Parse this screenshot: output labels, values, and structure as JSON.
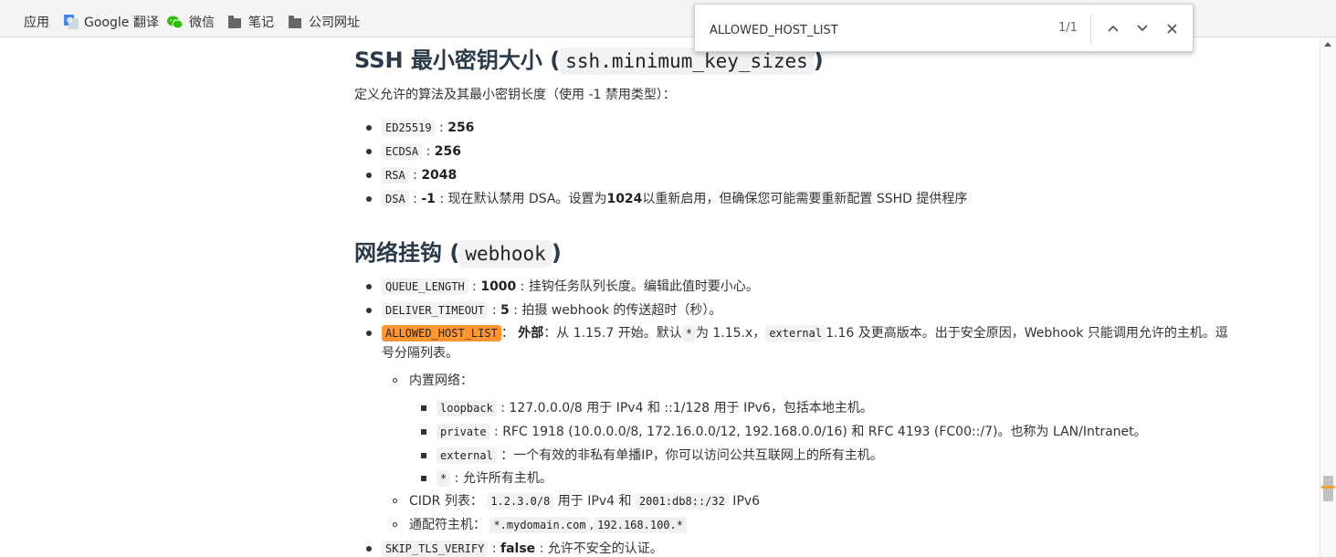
{
  "bookmarks": [
    {
      "label": "应用",
      "icon": "apps-grid-icon"
    },
    {
      "label": "Google 翻译",
      "icon": "google-translate-icon"
    },
    {
      "label": "微信",
      "icon": "wechat-icon"
    },
    {
      "label": "笔记",
      "icon": "folder-icon"
    },
    {
      "label": "公司网址",
      "icon": "folder-icon"
    }
  ],
  "find": {
    "query": "ALLOWED_HOST_LIST",
    "count": "1/1"
  },
  "ssh": {
    "heading_text": "SSH 最小密钥大小 (",
    "heading_code": "ssh.minimum_key_sizes",
    "heading_close": ")",
    "desc": "定义允许的算法及其最小密钥长度（使用 -1 禁用类型）：",
    "items": [
      {
        "code": "ED25519",
        "sep": " : ",
        "value": "256",
        "rest": ""
      },
      {
        "code": "ECDSA",
        "sep": " : ",
        "value": "256",
        "rest": ""
      },
      {
        "code": "RSA",
        "sep": " : ",
        "value": "2048",
        "rest": ""
      },
      {
        "code": "DSA",
        "sep": " : ",
        "value": "-1",
        "rest": " : 现在默认禁用 DSA。设置为",
        "bold2": "1024",
        "rest2": "以重新启用，但确保您可能需要重新配置 SSHD 提供程序"
      }
    ]
  },
  "webhook": {
    "heading_text": "网络挂钩 (",
    "heading_code": "webhook",
    "heading_close": ")",
    "queue": {
      "code": "QUEUE_LENGTH",
      "value": "1000",
      "rest": " : 挂钩任务队列长度。编辑此值时要小心。"
    },
    "deliver": {
      "code": "DELIVER_TIMEOUT",
      "value": "5",
      "rest": " : 拍摄 webhook 的传送超时（秒）。"
    },
    "allowed": {
      "code": "ALLOWED_HOST_LIST",
      "value": "外部",
      "rest1": "：从 1.15.7 开始。默认",
      "star": "*",
      "rest2": "为 1.15.x，",
      "external": "external",
      "rest3": "1.16 及更高版本。出于安全原因，Webhook 只能调用允许的主机。逗",
      "rest4": "号分隔列表。"
    },
    "builtin_label": "内置网络：",
    "builtin": [
      {
        "code": "loopback",
        "rest": " : 127.0.0.0/8 用于 IPv4 和 ::1/128 用于 IPv6，包括本地主机。"
      },
      {
        "code": "private",
        "rest": " : RFC 1918 (10.0.0.0/8, 172.16.0.0/12, 192.168.0.0/16) 和 RFC 4193 (FC00::/7)。也称为 LAN/Intranet。"
      },
      {
        "code": "external",
        "rest": " ：一个有效的非私有单播IP，你可以访问公共互联网上的所有主机。"
      },
      {
        "code": "*",
        "rest": " : 允许所有主机。"
      }
    ],
    "cidr": {
      "label": "CIDR 列表：",
      "code1": "1.2.3.0/8",
      "mid": " 用于 IPv4 和 ",
      "code2": "2001:db8::/32",
      "end": " IPv6"
    },
    "wildcard": {
      "label": "通配符主机：",
      "code1": "*.mydomain.com",
      "mid": ",",
      "code2": "192.168.100.*"
    },
    "skip": {
      "code": "SKIP_TLS_VERIFY",
      "value": "false",
      "rest": " : 允许不安全的认证。"
    }
  }
}
